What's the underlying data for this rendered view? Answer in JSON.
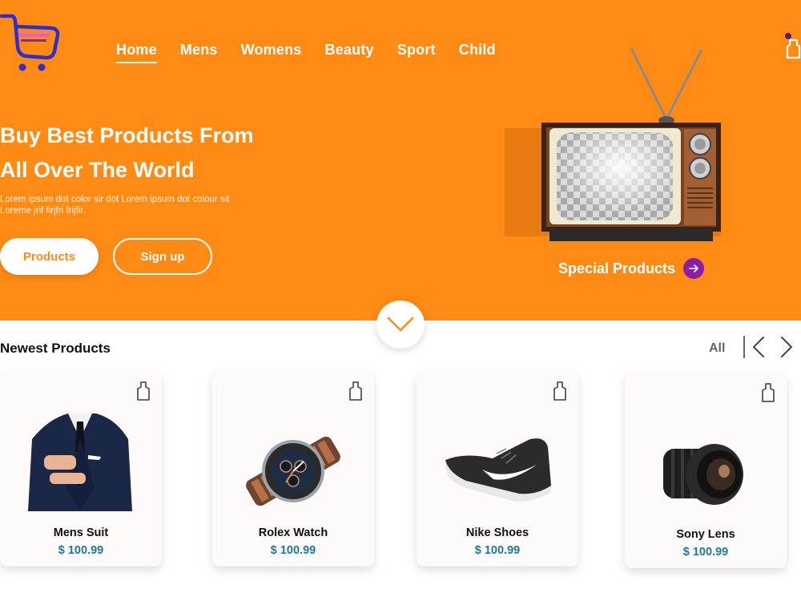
{
  "nav": {
    "items": [
      {
        "label": "Home",
        "active": true
      },
      {
        "label": "Mens"
      },
      {
        "label": "Womens"
      },
      {
        "label": "Beauty"
      },
      {
        "label": "Sport"
      },
      {
        "label": "Child"
      }
    ]
  },
  "hero": {
    "headline_line1": "Buy Best Products From",
    "headline_line2": "All Over The World",
    "subtext_line1": "Lorem ipsum dot color sir dot Lorem ipsum dot colour sit",
    "subtext_line2": "Loreme jrif firjfri frijfir.",
    "products_button": "Products",
    "signup_button": "Sign up",
    "special_label": "Special Products"
  },
  "section": {
    "title": "Newest Products",
    "all_label": "All"
  },
  "products": [
    {
      "name": "Mens Suit",
      "price": "$ 100.99"
    },
    {
      "name": "Rolex Watch",
      "price": "$ 100.99"
    },
    {
      "name": "Nike Shoes",
      "price": "$ 100.99"
    },
    {
      "name": "Sony Lens",
      "price": "$ 100.99"
    }
  ],
  "colors": {
    "accent": "#ff8a14",
    "price": "#1e7a95",
    "special_arrow": "#8a1ea8",
    "logo_cart": "#2d2fd6"
  },
  "icons": [
    "cart-logo-icon",
    "shopping-bag-icon",
    "chevron-down-icon",
    "chevron-left-icon",
    "chevron-right-icon",
    "arrow-right-icon"
  ]
}
